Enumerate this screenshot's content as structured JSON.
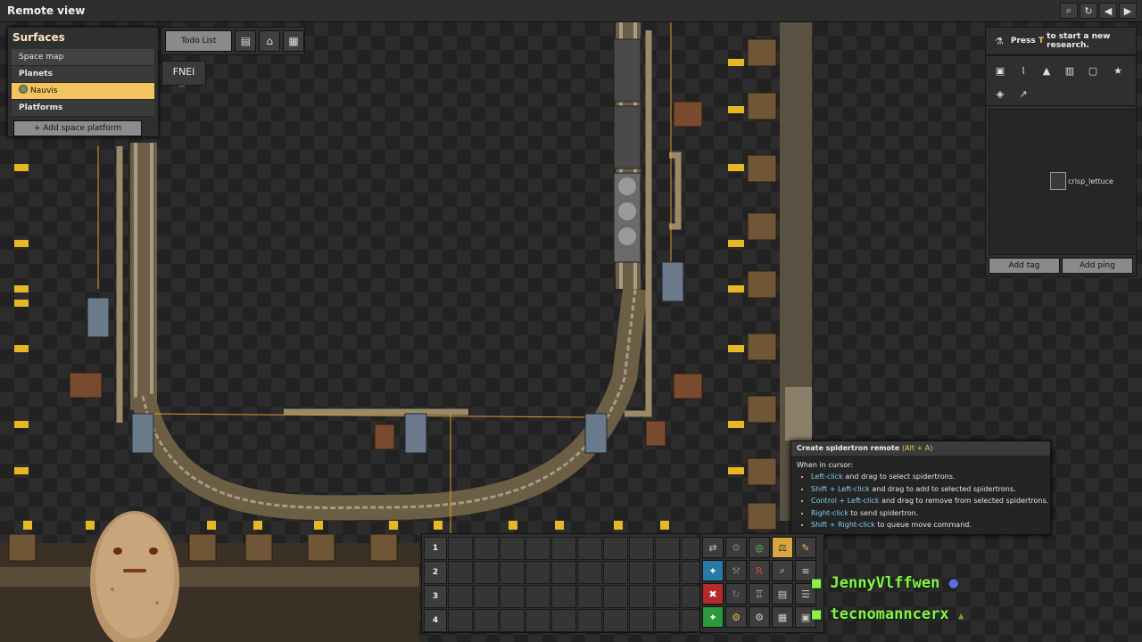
{
  "window": {
    "title": "Remote view",
    "controls": [
      "search-icon",
      "refresh-icon",
      "back-icon",
      "forward-icon"
    ]
  },
  "surfaces": {
    "header": "Surfaces",
    "space_map": "Space map",
    "planets_label": "Planets",
    "selected_planet": "Nauvis",
    "platforms_label": "Platforms",
    "add_platform": "+ Add space platform"
  },
  "toolbar": {
    "todo": "Todo List",
    "icons": [
      "blueprint-library-icon",
      "factoriopedia-icon",
      "calculator-icon"
    ],
    "fnei": "FNEI"
  },
  "research": {
    "prefix": "Press ",
    "key": "T",
    "suffix": " to start a new research."
  },
  "map_tools": [
    "map-view-icon",
    "production-stats-icon",
    "logistics-icon",
    "factoriopedia-book-icon",
    "trains-icon",
    "achievements-icon",
    "toggle-layers-icon",
    "tags-icon"
  ],
  "tags": {
    "tag_name": "crisp_lettuce",
    "add_tag": "Add tag",
    "add_ping": "Add ping"
  },
  "tooltip": {
    "title": "Create spidertron remote",
    "shortcut": "(Alt + A)",
    "when": "When in cursor:",
    "items": [
      {
        "key": "Left-click",
        "text": " and drag to select spidertrons."
      },
      {
        "key": "Shift + Left-click",
        "text": " and drag to add to selected spidertrons."
      },
      {
        "key": "Control + Left-click",
        "text": " and drag to remove from selected spidertrons."
      },
      {
        "key": "Right-click",
        "text": " to send spidertron."
      },
      {
        "key": "Shift + Right-click",
        "text": " to queue move command."
      }
    ]
  },
  "quickbar": {
    "rows": [
      "1",
      "2",
      "3",
      "4"
    ]
  },
  "chat": {
    "line1": "JennyVlffwen",
    "line2": "tecnomanncerx"
  },
  "colors": {
    "accent": "#f2c35f",
    "chat_green": "#8cf04a",
    "key_highlight": "#7fd0f0",
    "panel": "#2f2f2f"
  }
}
